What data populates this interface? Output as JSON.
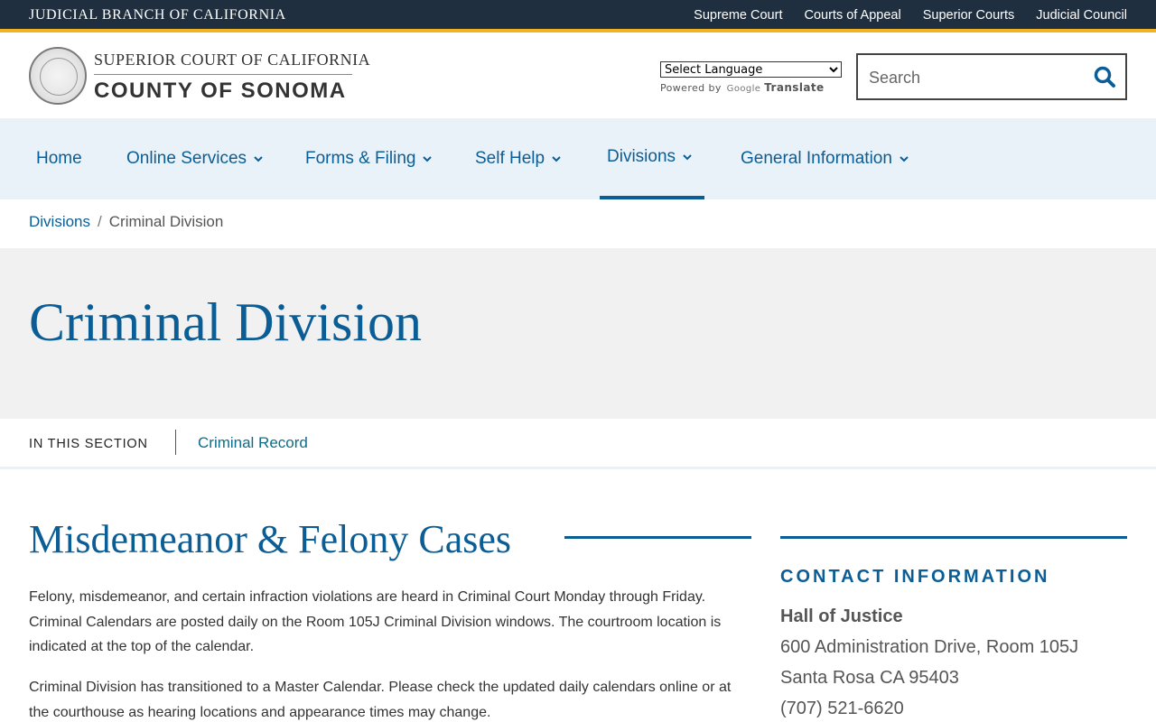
{
  "topbar": {
    "brand": "JUDICIAL BRANCH OF CALIFORNIA",
    "links": [
      "Supreme Court",
      "Courts of Appeal",
      "Superior Courts",
      "Judicial Council"
    ]
  },
  "header": {
    "court_line1": "SUPERIOR COURT OF CALIFORNIA",
    "court_line2": "COUNTY OF SONOMA",
    "language_select": "Select Language",
    "powered_by": "Powered by",
    "google": "Google",
    "translate": "Translate",
    "search_placeholder": "Search"
  },
  "nav": {
    "items": [
      "Home",
      "Online Services",
      "Forms & Filing",
      "Self Help",
      "Divisions",
      "General Information"
    ],
    "active": "Divisions"
  },
  "breadcrumb": {
    "parent": "Divisions",
    "separator": "/",
    "current": "Criminal Division"
  },
  "hero": {
    "title": "Criminal Division"
  },
  "in_section": {
    "label": "IN THIS SECTION",
    "links": [
      "Criminal Record"
    ]
  },
  "main": {
    "heading": "Misdemeanor & Felony Cases",
    "paragraphs": [
      "Felony, misdemeanor, and certain infraction violations are heard in Criminal Court Monday through Friday. Criminal Calendars are posted daily on the Room 105J Criminal Division windows. The courtroom location is indicated at the top of the calendar.",
      "Criminal Division has transitioned to a Master Calendar. Please check the updated daily calendars online or at the courthouse as hearing locations and appearance times may change."
    ]
  },
  "contact": {
    "title": "CONTACT INFORMATION",
    "name": "Hall of Justice",
    "address": "600 Administration Drive, Room 105J",
    "city": "Santa Rosa CA 95403",
    "phone": "(707) 521-6620"
  },
  "colors": {
    "topbar_bg": "#1f2f3f",
    "topbar_accent": "#f0b323",
    "primary_blue": "#0b5d96",
    "nav_bg": "#e9f2f8",
    "hero_bg": "#f1f1f1"
  },
  "icons": {
    "search": "search-icon",
    "chevron": "chevron-down-icon",
    "seal": "court-seal"
  }
}
